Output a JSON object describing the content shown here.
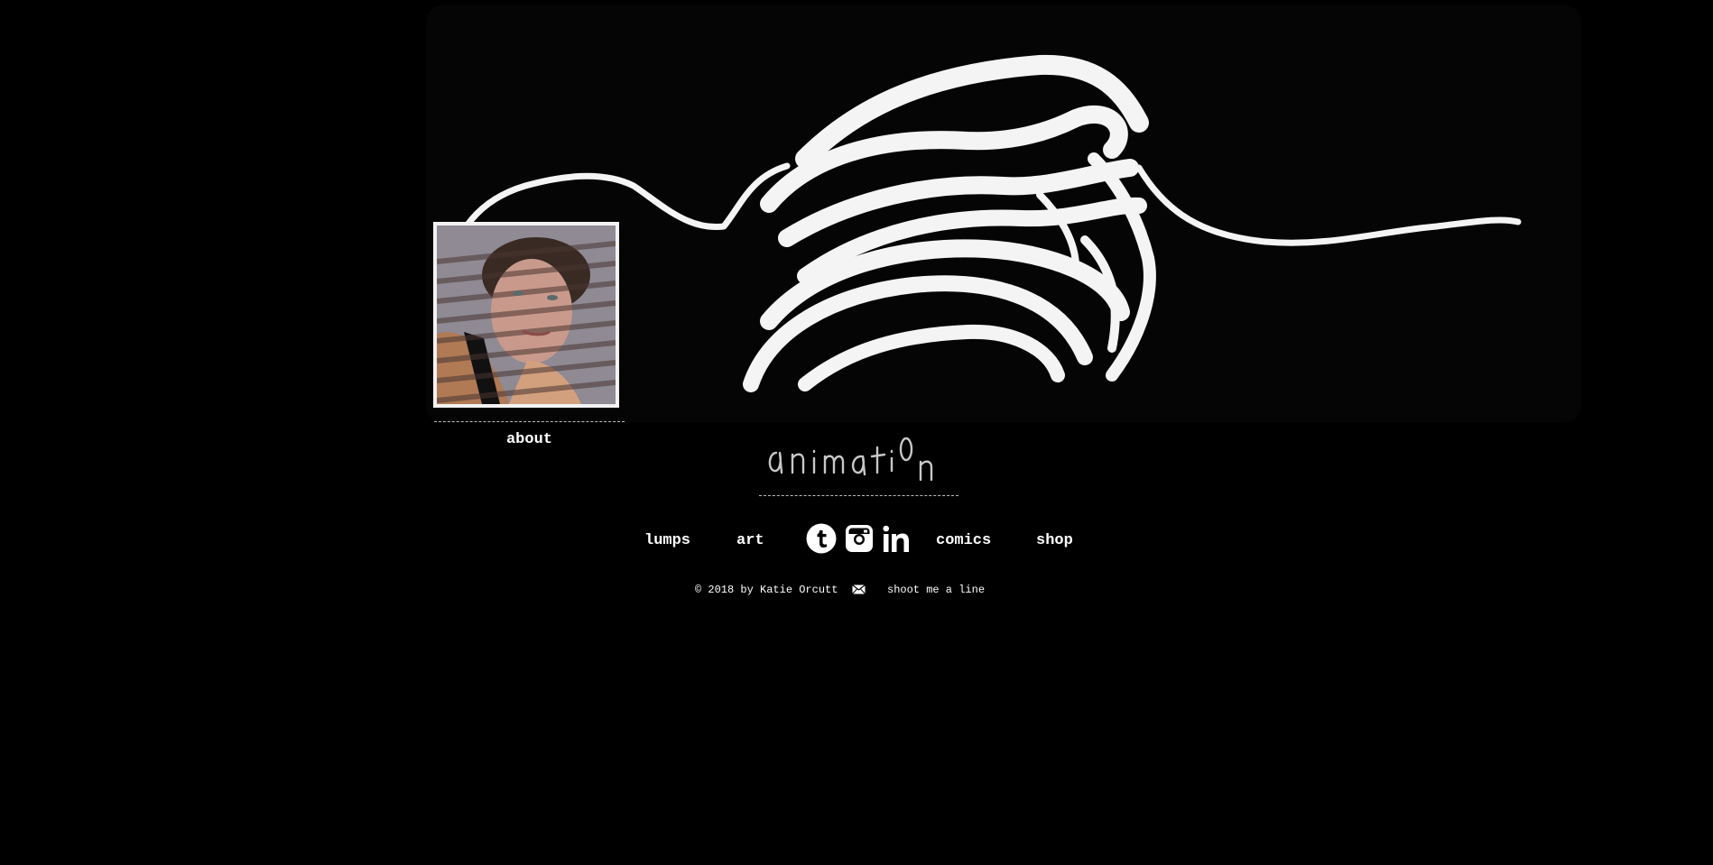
{
  "site": {
    "title": "animati0n",
    "brand_color": "#ffffff",
    "background": "#000000"
  },
  "sidebar": {
    "about_label": "about"
  },
  "nav": {
    "items": [
      {
        "label": "lumps"
      },
      {
        "label": "art"
      },
      {
        "label": "comics"
      },
      {
        "label": "shop"
      }
    ],
    "social": [
      {
        "icon": "tumblr-icon"
      },
      {
        "icon": "instagram-icon"
      },
      {
        "icon": "linkedin-icon"
      }
    ]
  },
  "footer": {
    "copyright": "© 2018 by Katie Orcutt",
    "mail_icon": "envelope-icon",
    "contact_label": "shoot me a line"
  }
}
